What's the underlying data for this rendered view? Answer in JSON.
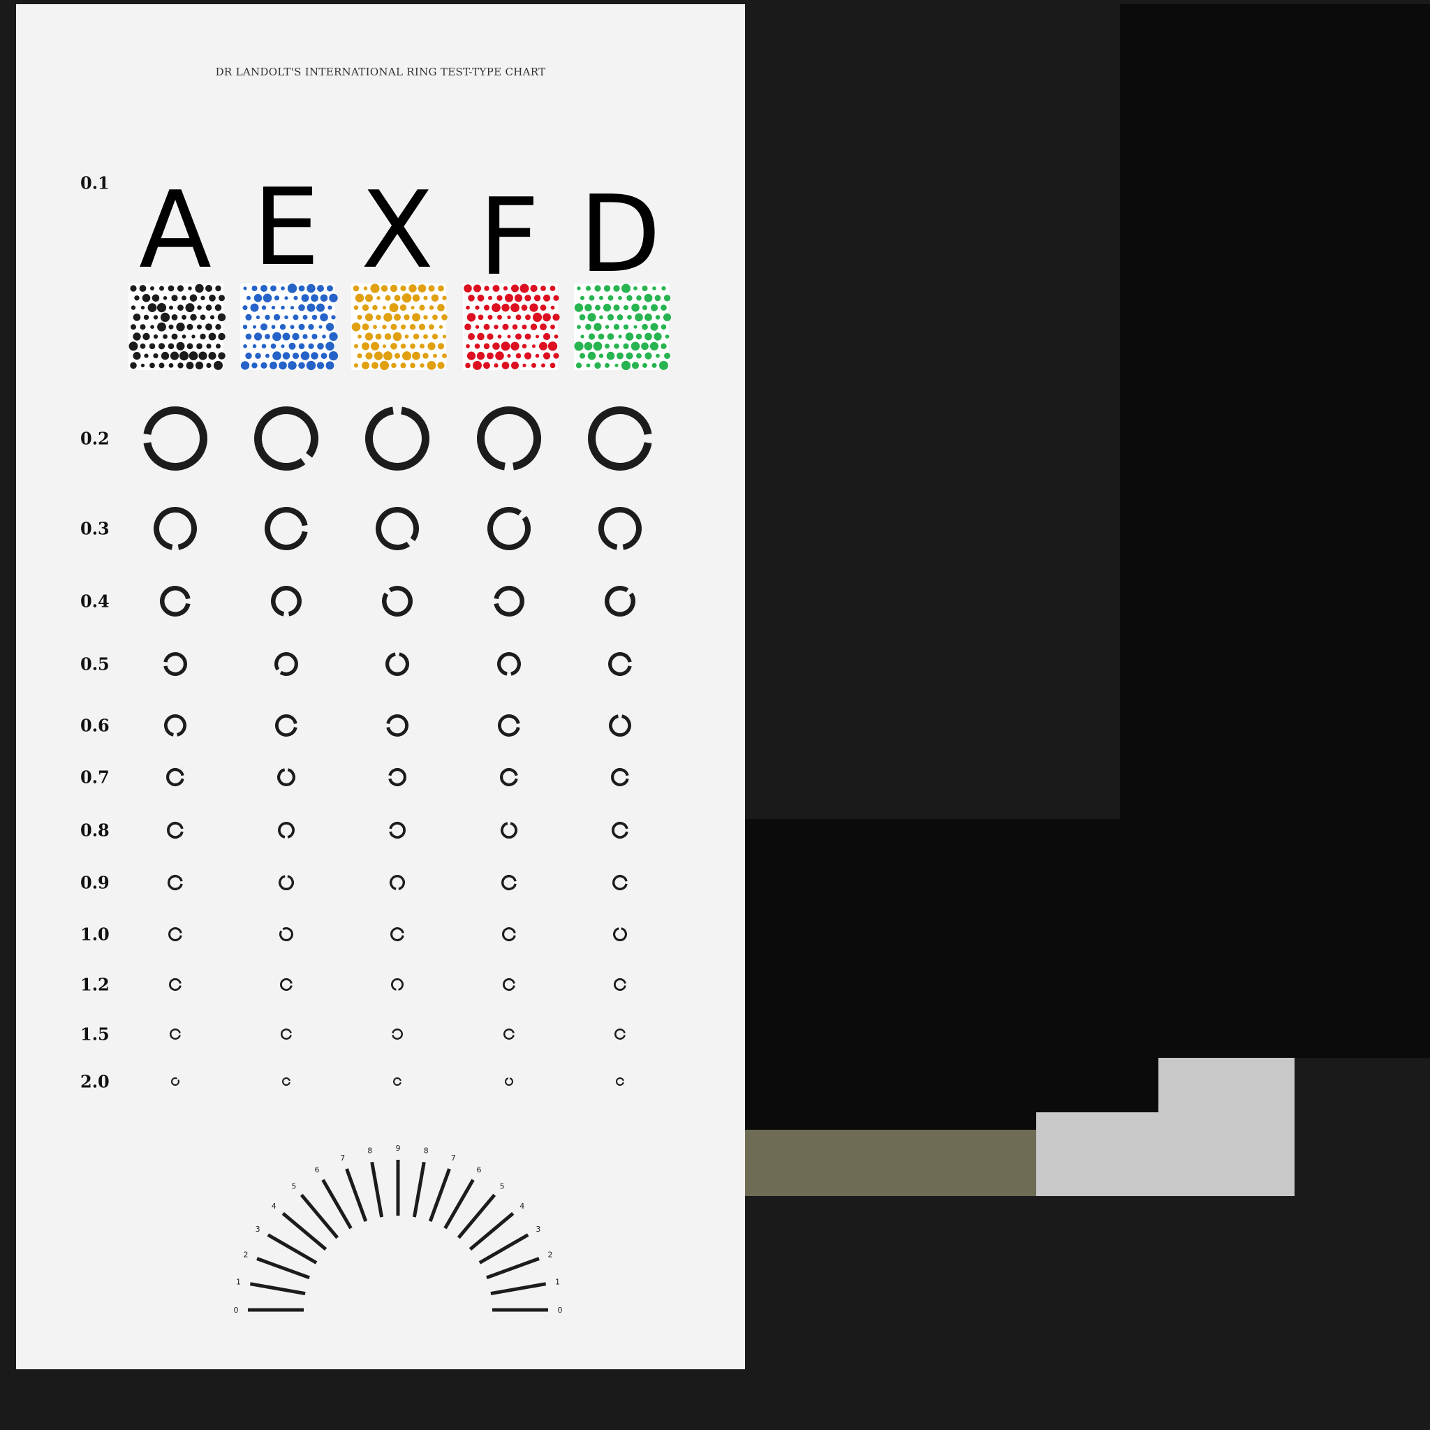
{
  "title": "DR LANDOLT'S INTERNATIONAL RING TEST-TYPE CHART",
  "top_row": {
    "acuity": "0.1",
    "letters": [
      "A",
      "E",
      "X",
      "F",
      "D"
    ]
  },
  "swatch_colors": [
    "#1c1c1c",
    "#2563c8",
    "#e0a010",
    "#dc1020",
    "#28b450"
  ],
  "ring_color": "#1c1c1c",
  "ring_rows": [
    {
      "acuity": "0.2",
      "gaps": [
        "left",
        "bottom-right",
        "top",
        "bottom",
        "right"
      ]
    },
    {
      "acuity": "0.3",
      "gaps": [
        "bottom",
        "right",
        "bottom-right",
        "top-right",
        "bottom"
      ]
    },
    {
      "acuity": "0.4",
      "gaps": [
        "right",
        "bottom",
        "top-left",
        "left",
        "top-right"
      ]
    },
    {
      "acuity": "0.5",
      "gaps": [
        "left",
        "bottom-left",
        "top",
        "bottom",
        "right"
      ]
    },
    {
      "acuity": "0.6",
      "gaps": [
        "bottom",
        "right",
        "left",
        "right",
        "top"
      ]
    },
    {
      "acuity": "0.7",
      "gaps": [
        "right",
        "top",
        "left",
        "right",
        "right"
      ]
    },
    {
      "acuity": "0.8",
      "gaps": [
        "right",
        "bottom",
        "left",
        "top",
        "right"
      ]
    },
    {
      "acuity": "0.9",
      "gaps": [
        "right",
        "top",
        "bottom",
        "right",
        "right"
      ]
    },
    {
      "acuity": "1.0",
      "gaps": [
        "right",
        "top-left",
        "right",
        "right",
        "top"
      ]
    },
    {
      "acuity": "1.2",
      "gaps": [
        "right",
        "right",
        "bottom",
        "right",
        "right"
      ]
    },
    {
      "acuity": "1.5",
      "gaps": [
        "right",
        "right",
        "left",
        "right",
        "right"
      ]
    },
    {
      "acuity": "2.0",
      "gaps": [
        "top-right",
        "right",
        "right",
        "top",
        "right"
      ]
    }
  ],
  "astigmatic_fan": {
    "labels": [
      "0",
      "1",
      "2",
      "3",
      "4",
      "5",
      "6",
      "7",
      "8",
      "9",
      "8",
      "7",
      "6",
      "5",
      "4",
      "3",
      "2",
      "1",
      "0"
    ]
  }
}
